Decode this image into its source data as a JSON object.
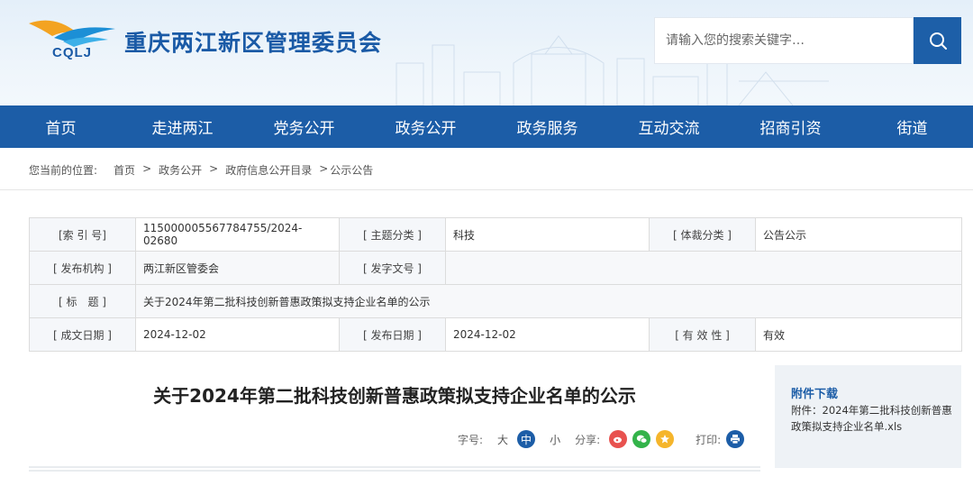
{
  "header": {
    "logo_text": "CQLJ",
    "site_title": "重庆两江新区管理委员会",
    "search_placeholder": "请输入您的搜索关键字…"
  },
  "nav": {
    "items": [
      "首页",
      "走进两江",
      "党务公开",
      "政务公开",
      "政务服务",
      "互动交流",
      "招商引资",
      "街道"
    ]
  },
  "breadcrumb": {
    "prefix": "您当前的位置:",
    "items": [
      "首页",
      "政务公开",
      "政府信息公开目录",
      "公示公告"
    ],
    "separator": ">"
  },
  "info": {
    "index_label": "[索 引 号]",
    "index_value": "115000005567784755/2024-02680",
    "topic_label": "[ 主题分类 ]",
    "topic_value": "科技",
    "genre_label": "[ 体裁分类 ]",
    "genre_value": "公告公示",
    "publisher_label": "[ 发布机构 ]",
    "publisher_value": "两江新区管委会",
    "docno_label": "[ 发字文号 ]",
    "docno_value": "",
    "title_label": "[ 标　题 ]",
    "title_value": "关于2024年第二批科技创新普惠政策拟支持企业名单的公示",
    "created_label": "[ 成文日期 ]",
    "created_value": "2024-12-02",
    "published_label": "[ 发布日期 ]",
    "published_value": "2024-12-02",
    "validity_label": "[ 有 效 性 ]",
    "validity_value": "有效"
  },
  "article": {
    "title": "关于2024年第二批科技创新普惠政策拟支持企业名单的公示",
    "font_size_label": "字号:",
    "font_sizes": [
      "大",
      "中",
      "小"
    ],
    "share_label": "分享:",
    "print_label": "打印:"
  },
  "attachment": {
    "title": "附件下载",
    "file": "附件：2024年第二批科技创新普惠政策拟支持企业名单.xls"
  },
  "colors": {
    "primary": "#1c5da7",
    "weibo": "#e8524f",
    "wechat": "#33b34a",
    "qzone": "#f5b52b"
  }
}
